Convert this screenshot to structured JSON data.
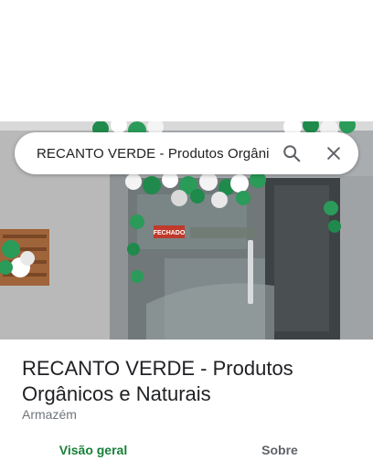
{
  "search": {
    "query": "RECANTO VERDE - Produtos Orgâni",
    "search_icon": "search-icon",
    "close_icon": "close-icon"
  },
  "photo": {
    "sign_text": "FECHADO"
  },
  "place": {
    "title": "RECANTO VERDE - Produtos Orgânicos e Naturais",
    "category": "Armazém"
  },
  "tabs": [
    {
      "label": "Visão geral",
      "active": true
    },
    {
      "label": "Sobre",
      "active": false
    }
  ],
  "colors": {
    "accent": "#188038",
    "text_primary": "#202124",
    "text_secondary": "#70757a"
  }
}
